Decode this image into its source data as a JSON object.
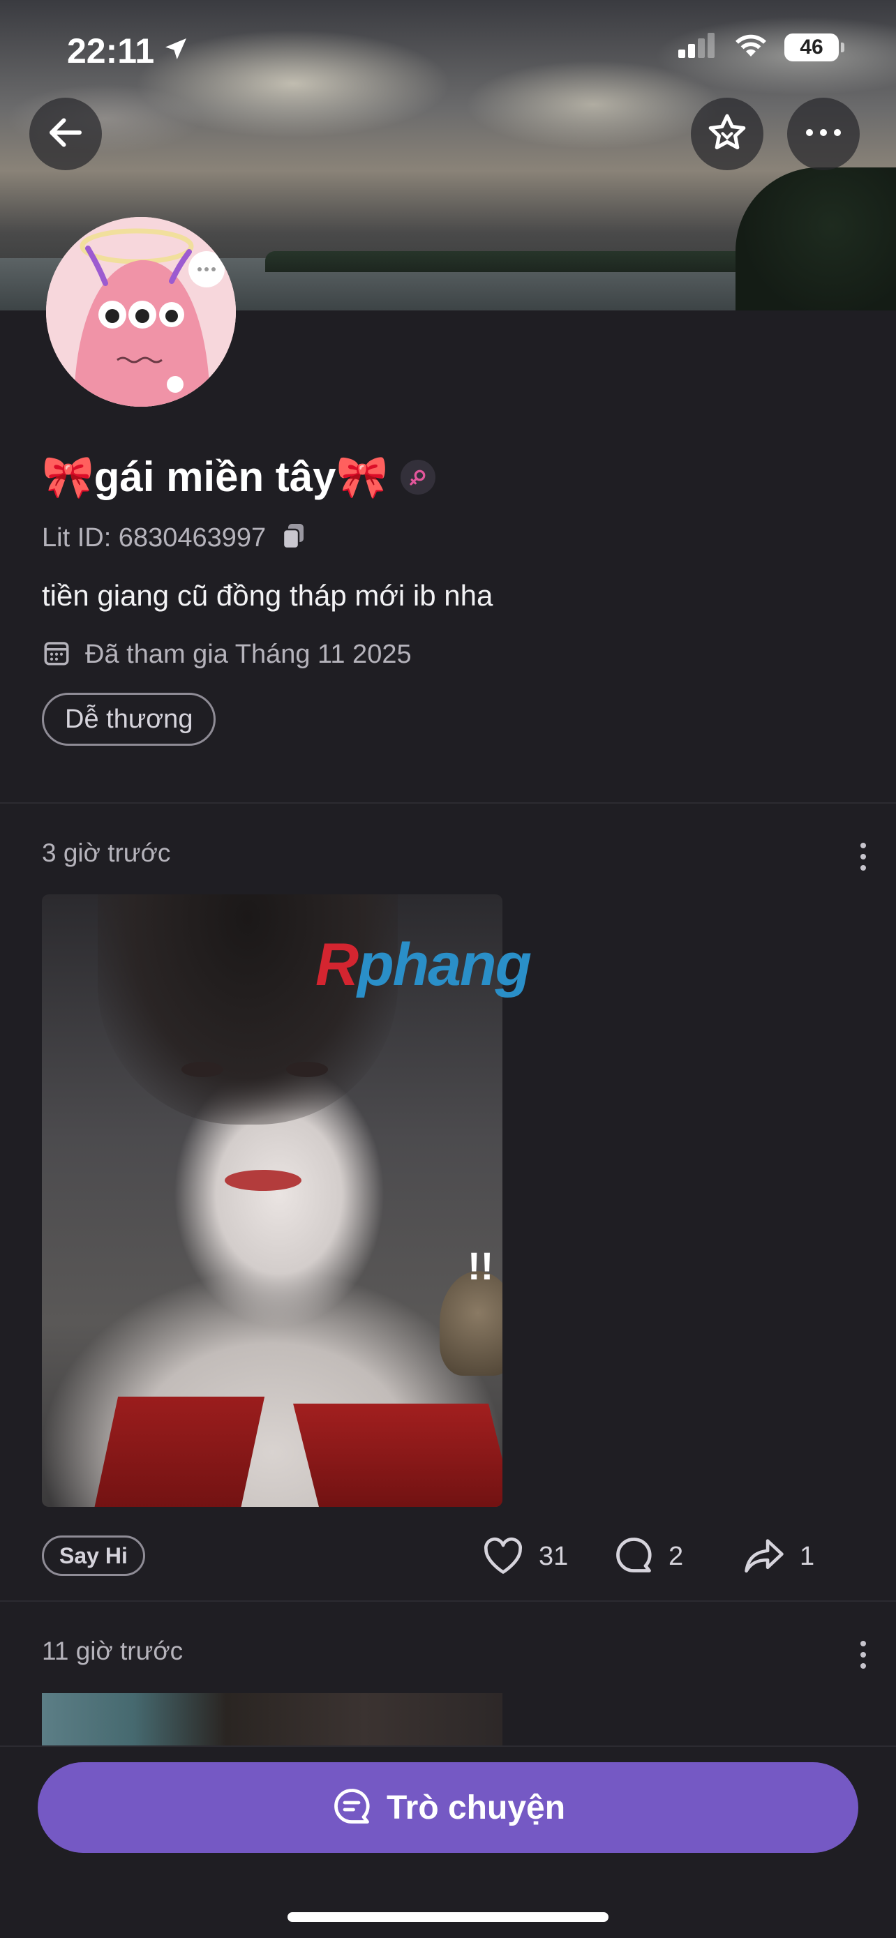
{
  "status_bar": {
    "time": "22:11",
    "battery": "46",
    "icons": [
      "location-arrow-icon",
      "cellular-signal-icon",
      "wifi-icon",
      "battery-icon"
    ]
  },
  "header": {
    "icons": [
      "back-arrow-icon",
      "star-icon",
      "more-horizontal-icon"
    ]
  },
  "profile": {
    "name": "🎀gái miền tây🎀",
    "gender_icon": "female-icon",
    "lit_id": "Lit ID: 6830463997",
    "bio": "tiền giang cũ đồng tháp mới ib nha",
    "joined": "Đã tham gia Tháng 11 2025",
    "tag": "Dễ thương"
  },
  "posts": [
    {
      "time": "3 giờ trước",
      "watermark": "Rphang",
      "sayhi_label": "Say Hi",
      "likes": "31",
      "comments": "2",
      "shares": "1"
    },
    {
      "time": "11 giờ trước"
    }
  ],
  "bottom": {
    "chat_label": "Trò chuyện",
    "chat_icon": "chat-bubble-icon"
  },
  "colors": {
    "background": "#1f1e23",
    "accent": "#7559c4",
    "secondary_text": "#b5b3bb",
    "gender_pink": "#e2569a"
  }
}
